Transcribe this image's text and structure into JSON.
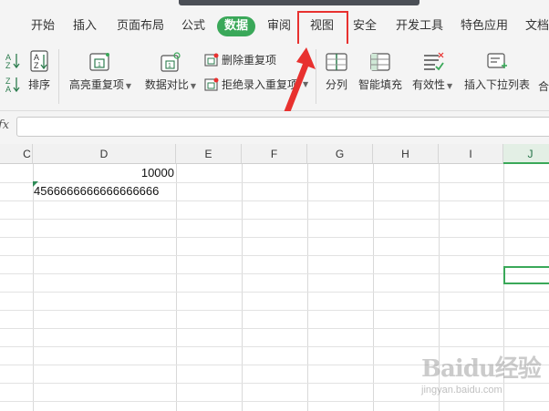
{
  "menu": {
    "tabs": [
      {
        "label": "开始"
      },
      {
        "label": "插入"
      },
      {
        "label": "页面布局"
      },
      {
        "label": "公式"
      },
      {
        "label": "数据"
      },
      {
        "label": "审阅"
      },
      {
        "label": "视图"
      },
      {
        "label": "安全"
      },
      {
        "label": "开发工具"
      },
      {
        "label": "特色应用"
      },
      {
        "label": "文档"
      }
    ],
    "active_tab": "数据",
    "highlighted_tab": "视图"
  },
  "ribbon": {
    "sort_label": "排序",
    "highlight_dup_label": "高亮重复项",
    "compare_label": "数据对比",
    "remove_dup_label": "删除重复项",
    "reject_dup_label": "拒绝录入重复项",
    "split_label": "分列",
    "smart_fill_label": "智能填充",
    "validity_label": "有效性",
    "insert_dropdown_label": "插入下拉列表",
    "merge_label": "合"
  },
  "formula_bar": {
    "fx_label": "fx",
    "value": ""
  },
  "sheet": {
    "columns": [
      "C",
      "D",
      "E",
      "F",
      "G",
      "H",
      "I",
      "J"
    ],
    "selected_column": "J",
    "cells": {
      "D1": "10000",
      "D2": "4566666666666666666"
    }
  },
  "watermark": {
    "logo": "Baidu经验",
    "url": "jingyan.baidu.com"
  },
  "colors": {
    "accent_green": "#3aa859",
    "annotation_red": "#e8312f",
    "background": "#f4f4f4"
  }
}
